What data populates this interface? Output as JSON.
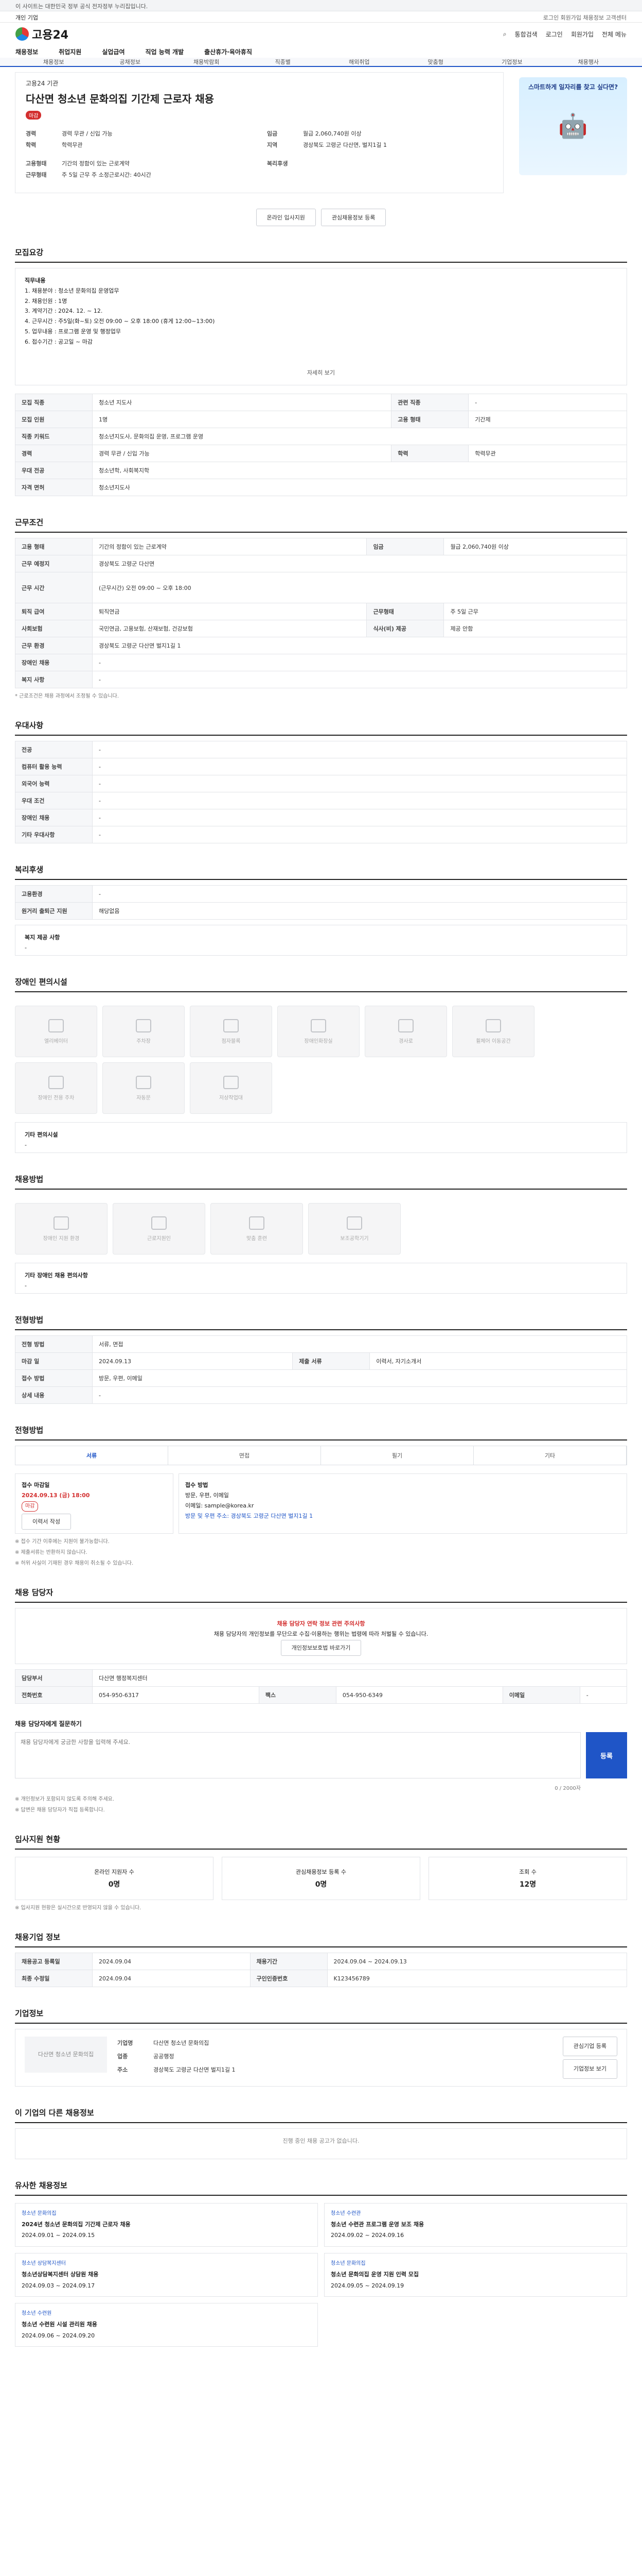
{
  "notice": "이 사이트는 대한민국 정부 공식 전자정부 누리집입니다.",
  "topbar": {
    "left": "개인  기업",
    "right": "로그인  회원가입  채용정보  고객센터"
  },
  "header": {
    "logo": "고용24",
    "search_label": "통합검색",
    "login": "로그인",
    "signup": "회원가입",
    "menu": "전체 메뉴"
  },
  "gnb": [
    "채용정보",
    "취업지원",
    "실업급여",
    "직업 능력 개발",
    "출산휴가·육아휴직"
  ],
  "subnav": [
    "채용정보",
    "공채정보",
    "채용박람회",
    "직종별",
    "해외취업",
    "맞춤형",
    "기업정보",
    "채용행사"
  ],
  "job": {
    "company": "고용24 기관",
    "title": "다산면 청소년 문화의집 기간제 근로자 채용",
    "status": "마감",
    "left": [
      {
        "k": "경력",
        "v": "경력 무관 / 신입 가능"
      },
      {
        "k": "학력",
        "v": "학력무관"
      }
    ],
    "right": [
      {
        "k": "임금",
        "v": "월급 2,060,740원 이상"
      },
      {
        "k": "지역",
        "v": "경상북도 고령군 다산면, 벌지1길 1"
      }
    ],
    "extra_left": [
      {
        "k": "고용형태",
        "v": "기간의 정함이 있는 근로계약"
      },
      {
        "k": "근무형태",
        "v": "주 5일 근무 주 소정근로시간: 40시간"
      }
    ],
    "extra_right": [
      {
        "k": "복리후생",
        "v": ""
      }
    ]
  },
  "side_banner": "스마트하게 일자리를 찾고 싶다면?",
  "actions": {
    "apply": "온라인 입사지원",
    "scrap": "관심채용정보 등록",
    "print": "인쇄하기"
  },
  "sections": {
    "duty": "모집요강",
    "conditions": "근무조건",
    "qualification": "우대사항",
    "welfare": "복리후생",
    "facilities": "장애인 편의시설",
    "method": "채용방법",
    "process": "전형방법",
    "contact": "채용 담당자",
    "stats": "입사지원 현황",
    "manage": "채용기업 정보",
    "company": "기업정보",
    "related": "이 기업의 다른 채용정보",
    "similar": "유사한 채용정보"
  },
  "duty": {
    "label": "직무내용",
    "lines": [
      "1. 채용분야 : 청소년 문화의집 운영업무",
      "2. 채용인원 : 1명",
      "3. 계약기간 : 2024. 12. ~ 12.",
      "4. 근무시간 : 주5일(화~토) 오전 09:00 ~ 오후 18:00 (휴게 12:00~13:00)",
      "5. 업무내용 : 프로그램 운영 및 행정업무",
      "6. 접수기간 : 공고일 ~ 마감"
    ],
    "more": "자세히 보기"
  },
  "info_rows": [
    {
      "k": "모집 직종",
      "v": "청소년 지도사",
      "k2": "관련 직종",
      "v2": "-"
    },
    {
      "k": "모집 인원",
      "v": "1명",
      "k2": "고용 형태",
      "v2": "기간제"
    },
    {
      "k": "직종 키워드",
      "v": "청소년지도사, 문화의집 운영, 프로그램 운영",
      "k2": "",
      "v2": ""
    },
    {
      "k": "경력",
      "v": "경력 무관 / 신입 가능",
      "k2": "학력",
      "v2": "학력무관"
    },
    {
      "k": "우대 전공",
      "v": "청소년학, 사회복지학",
      "k2": "",
      "v2": ""
    },
    {
      "k": "자격 면허",
      "v": "청소년지도사",
      "k2": "",
      "v2": ""
    }
  ],
  "cond_rows": [
    {
      "k": "고용 형태",
      "v": "기간의 정함이 있는 근로계약",
      "k2": "임금",
      "v2": "월급 2,060,740원 이상"
    },
    {
      "k": "근무 예정지",
      "v": "경상북도 고령군 다산면",
      "k2": "",
      "v2": ""
    },
    {
      "k": "근무 시간",
      "v": "(근무시간) 오전 09:00 ~ 오후 18:00",
      "k2": "",
      "v2": ""
    },
    {
      "k": "퇴직 급여",
      "v": "퇴직연금",
      "k2": "근무형태",
      "v2": "주 5일 근무"
    },
    {
      "k": "사회보험",
      "v": "국민연금, 고용보험, 산재보험, 건강보험",
      "k2": "식사(비) 제공",
      "v2": "제공 안함"
    },
    {
      "k": "근무 환경",
      "v": "경상북도 고령군 다산면 벌지1길 1",
      "k2": "",
      "v2": ""
    },
    {
      "k": "장애인 채용",
      "v": "-",
      "k2": "",
      "v2": ""
    },
    {
      "k": "복지 사항",
      "v": "-",
      "k2": "",
      "v2": ""
    }
  ],
  "cond_note": "* 근로조건은 채용 과정에서 조정될 수 있습니다.",
  "qual_rows": [
    {
      "k": "전공",
      "v": "-"
    },
    {
      "k": "컴퓨터 활용 능력",
      "v": "-"
    },
    {
      "k": "외국어 능력",
      "v": "-"
    },
    {
      "k": "우대 조건",
      "v": "-"
    },
    {
      "k": "장애인 채용",
      "v": "-"
    },
    {
      "k": "기타 우대사항",
      "v": "-"
    }
  ],
  "welfare_rows": [
    {
      "k": "고용환경",
      "v": "-"
    },
    {
      "k": "원거리 출퇴근 지원",
      "v": "해당없음"
    }
  ],
  "welfare_extra": "복지 제공 사항",
  "welfare_dash": "-",
  "fac_tiles": [
    "엘리베이터",
    "주차장",
    "점자블록",
    "장애인화장실",
    "경사로",
    "휠체어 이동공간",
    "장애인 전용 주차",
    "자동문",
    "저상작업대"
  ],
  "fac_etc": "기타 편의시설",
  "fac_etc_v": "-",
  "method_tiles": [
    "장애인 지원 환경",
    "근로지원인",
    "맞춤 훈련",
    "보조공학기기"
  ],
  "method_etc": "기타 장애인 채용 편의사항",
  "method_etc_v": "-",
  "method_rows": [
    {
      "k": "전형 방법",
      "v": "서류, 면접",
      "k2": "",
      "v2": ""
    },
    {
      "k": "마감 일",
      "v": "2024.09.13",
      "k2": "제출 서류",
      "v2": "이력서, 자기소개서"
    },
    {
      "k": "접수 방법",
      "v": "방문, 우편, 이메일",
      "k2": "",
      "v2": ""
    },
    {
      "k": "상세 내용",
      "v": "-",
      "k2": "",
      "v2": ""
    }
  ],
  "proc_tabs": [
    "서류",
    "면접",
    "필기",
    "기타"
  ],
  "proc": {
    "left_title": "접수 마감일",
    "left_date": "2024.09.13 (금) 18:00",
    "left_status": "마감",
    "left_btn": "이력서 작성",
    "right_title": "접수 방법",
    "right_lines": [
      "방문, 우편, 이메일",
      "이메일: sample@korea.kr",
      "방문 및 우편 주소: 경상북도 고령군 다산면 벌지1길 1"
    ]
  },
  "proc_notes": [
    "※ 접수 기간 이후에는 지원이 불가능합니다.",
    "※ 제출서류는 반환하지 않습니다.",
    "※ 허위 사실이 기재된 경우 채용이 취소될 수 있습니다."
  ],
  "contact": {
    "alert": "채용 담당자 연락 정보 관련 주의사항",
    "text": "채용 담당자의 개인정보를 무단으로 수집·이용하는 행위는 법령에 따라 처벌될 수 있습니다.",
    "link": "개인정보보호법 바로가기",
    "dept_label": "담당부서",
    "dept": "다산면 행정복지센터",
    "tel_label": "전화번호",
    "tel": "054-950-6317",
    "fax_label": "팩스",
    "fax": "054-950-6349",
    "email_label": "이메일",
    "email": "-"
  },
  "inquiry": {
    "label": "채용 담당자에게 질문하기",
    "placeholder": "채용 담당자에게 궁금한 사항을 입력해 주세요.",
    "count": "0 / 2000자",
    "submit": "등록",
    "notes": [
      "※ 개인정보가 포함되지 않도록 주의해 주세요.",
      "※ 답변은 채용 담당자가 직접 등록합니다."
    ]
  },
  "stats": [
    {
      "label": "온라인 지원자 수",
      "value": "0명"
    },
    {
      "label": "관심채용정보 등록 수",
      "value": "0명"
    },
    {
      "label": "조회 수",
      "value": "12명"
    }
  ],
  "stats_note": "※ 입사지원 현황은 실시간으로 반영되지 않을 수 있습니다.",
  "manage_rows": [
    {
      "k": "채용공고 등록일",
      "v": "2024.09.04",
      "k2": "채용기간",
      "v2": "2024.09.04 ~ 2024.09.13"
    },
    {
      "k": "최종 수정일",
      "v": "2024.09.04",
      "k2": "구인인증번호",
      "v2": "K123456789"
    }
  ],
  "company": {
    "name": "다산면 청소년 문화의집",
    "rows": [
      {
        "k": "기업명",
        "v": "다산면 청소년 문화의집"
      },
      {
        "k": "업종",
        "v": "공공행정"
      },
      {
        "k": "주소",
        "v": "경상북도 고령군 다산면 벌지1길 1"
      }
    ],
    "btn1": "관심기업 등록",
    "btn2": "기업정보 보기"
  },
  "related_empty": "진행 중인 채용 공고가 없습니다.",
  "similar": [
    {
      "tag": "청소년 문화의집",
      "title": "2024년 청소년 문화의집 기간제 근로자 채용",
      "date": "2024.09.01 ~ 2024.09.15"
    },
    {
      "tag": "청소년 수련관",
      "title": "청소년 수련관 프로그램 운영 보조 채용",
      "date": "2024.09.02 ~ 2024.09.16"
    },
    {
      "tag": "청소년 상담복지센터",
      "title": "청소년상담복지센터 상담원 채용",
      "date": "2024.09.03 ~ 2024.09.17"
    },
    {
      "tag": "청소년 문화의집",
      "title": "청소년 문화의집 운영 지원 인력 모집",
      "date": "2024.09.05 ~ 2024.09.19"
    },
    {
      "tag": "청소년 수련원",
      "title": "청소년 수련원 시설 관리원 채용",
      "date": "2024.09.06 ~ 2024.09.20"
    }
  ]
}
